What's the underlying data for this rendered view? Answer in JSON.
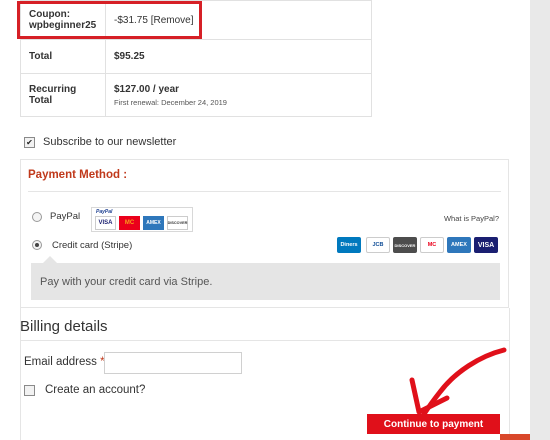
{
  "order_summary": {
    "coupon_label": "Coupon:",
    "coupon_code": "wpbeginner25",
    "coupon_amount": "-$31.75",
    "remove_label": "[Remove]",
    "total_label": "Total",
    "total_value": "$95.25",
    "recurring_label_line1": "Recurring",
    "recurring_label_line2": "Total",
    "recurring_value": "$127.00 / year",
    "first_renewal": "First renewal: December 24, 2019"
  },
  "newsletter": {
    "label": "Subscribe to our newsletter",
    "checked": true
  },
  "payment": {
    "title": "Payment Method :",
    "paypal_label": "PayPal",
    "paypal_mini_logo": "PayPal",
    "what_is_paypal": "What is PayPal?",
    "paypal_cards": [
      "VISA",
      "MC",
      "AMEX",
      "DISCOVER"
    ],
    "stripe_label": "Credit card (Stripe)",
    "selected_method": "stripe",
    "stripe_cards": [
      "Diners",
      "JCB",
      "DISCOVER",
      "MC",
      "AMEX",
      "VISA"
    ],
    "stripe_description": "Pay with your credit card via Stripe."
  },
  "billing": {
    "title": "Billing details",
    "email_label": "Email address",
    "email_required_mark": "*",
    "email_value": "",
    "create_account_label": "Create an account?",
    "continue_label": "Continue to payment"
  },
  "colors": {
    "highlight": "#d62026",
    "payment_title": "#c0391b",
    "continue_button": "#e0101a",
    "arrow": "#e0101a"
  }
}
